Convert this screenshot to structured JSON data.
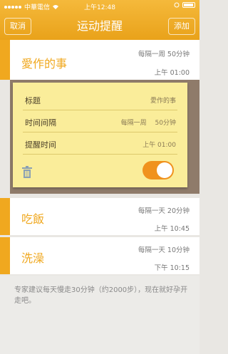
{
  "status": {
    "carrier": "中華電信",
    "time": "上午12:48"
  },
  "nav": {
    "cancel": "取消",
    "title": "运动提醒",
    "add": "添加"
  },
  "items": [
    {
      "name": "愛作的事",
      "interval": "每隔一周 50分钟",
      "time": "上午 01:00"
    },
    {
      "name": "吃飯",
      "interval": "每隔一天 20分钟",
      "time": "上午 10:45"
    },
    {
      "name": "洗澡",
      "interval": "每隔一天 10分钟",
      "time": "下午 10:15"
    }
  ],
  "detail": {
    "title_label": "标题",
    "title_value": "愛作的事",
    "interval_label": "时间间隔",
    "interval_value": "每隔一周　 50分钟",
    "remind_label": "提醒时间",
    "remind_value": "上午 01:00",
    "enabled": true
  },
  "footer": {
    "text": "专家建议每天慢走30分钟（约2000步），现在就好孕开走吧。"
  },
  "colors": {
    "accent": "#f0a81f",
    "note": "#faed9a",
    "toggle": "#f0921e"
  }
}
